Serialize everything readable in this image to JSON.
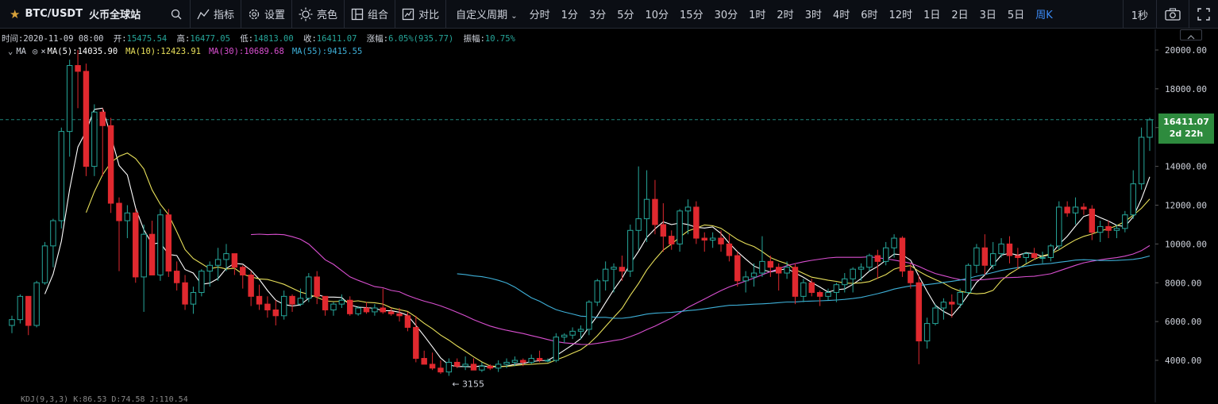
{
  "toolbar": {
    "symbol": "BTC/USDT",
    "exchange": "火币全球站",
    "tools": [
      {
        "label": "指标"
      },
      {
        "label": "设置"
      },
      {
        "label": "亮色"
      },
      {
        "label": "组合"
      },
      {
        "label": "对比"
      }
    ],
    "custom_period": "自定义周期",
    "periods": [
      "分时",
      "1分",
      "3分",
      "5分",
      "10分",
      "15分",
      "30分",
      "1时",
      "2时",
      "3时",
      "4时",
      "6时",
      "12时",
      "1日",
      "2日",
      "3日",
      "5日",
      "周K"
    ],
    "active_period": "周K",
    "refresh": "1秒"
  },
  "ohlc": {
    "time_label": "时间:",
    "time": "2020-11-09 08:00",
    "open_label": "开:",
    "open": "15475.54",
    "high_label": "高:",
    "high": "16477.05",
    "low_label": "低:",
    "low": "14813.00",
    "close_label": "收:",
    "close": "16411.07",
    "change_label": "涨幅:",
    "change": "6.05%(935.77)",
    "amp_label": "振幅:",
    "amp": "10.75%"
  },
  "ma_legend": {
    "name": "MA",
    "ma5": "MA(5):14035.90",
    "ma10": "MA(10):12423.91",
    "ma30": "MA(30):10689.68",
    "ma55": "MA(55):9415.55"
  },
  "kdj_legend": "KDJ(9,3,3)   K:86.53  D:74.58  J:110.54",
  "last_price": "16411.07",
  "countdown": "2d 22h",
  "low_marker": "← 3155",
  "colors": {
    "up": "#26a69a",
    "down": "#e0292f",
    "ma5": "#ffffff",
    "ma10": "#e8e05a",
    "ma30": "#d94fd0",
    "ma55": "#3eb0d8",
    "active": "#3c8bf5",
    "price_tag": "#2e8b3e"
  },
  "chart_data": {
    "type": "candlestick",
    "y_axis": {
      "ticks": [
        4000,
        6000,
        8000,
        10000,
        12000,
        14000,
        16000,
        18000,
        20000
      ],
      "range": [
        2700,
        21000
      ]
    },
    "candles": [
      [
        5800,
        6300,
        5400,
        6100
      ],
      [
        6100,
        7400,
        5900,
        7300
      ],
      [
        7300,
        6000,
        5300,
        5800
      ],
      [
        5800,
        8100,
        5700,
        8000
      ],
      [
        8000,
        10100,
        7900,
        9900
      ],
      [
        9900,
        11300,
        8800,
        11200
      ],
      [
        11200,
        16000,
        10800,
        15800
      ],
      [
        15800,
        19500,
        14500,
        19200
      ],
      [
        19200,
        20000,
        17000,
        18900
      ],
      [
        18900,
        19300,
        13500,
        14000
      ],
      [
        14000,
        17200,
        13500,
        16800
      ],
      [
        16800,
        17000,
        13500,
        16100
      ],
      [
        16100,
        16500,
        11600,
        12100
      ],
      [
        12100,
        12400,
        8600,
        11200
      ],
      [
        11200,
        12000,
        10300,
        11600
      ],
      [
        11600,
        11800,
        8000,
        8300
      ],
      [
        8300,
        11000,
        6500,
        10500
      ],
      [
        10500,
        11200,
        8600,
        8400
      ],
      [
        8400,
        11800,
        8100,
        11500
      ],
      [
        11500,
        11800,
        8300,
        8600
      ],
      [
        8600,
        9100,
        7600,
        8000
      ],
      [
        8000,
        8400,
        6600,
        6900
      ],
      [
        6900,
        7800,
        6400,
        7500
      ],
      [
        7500,
        8700,
        7300,
        8600
      ],
      [
        8600,
        9100,
        7800,
        8900
      ],
      [
        8900,
        9800,
        8100,
        9200
      ],
      [
        9200,
        10000,
        8600,
        9500
      ],
      [
        9500,
        9300,
        8400,
        8800
      ],
      [
        8800,
        8900,
        7700,
        8400
      ],
      [
        8400,
        8600,
        6800,
        7300
      ],
      [
        7300,
        7900,
        6600,
        6900
      ],
      [
        6900,
        7300,
        6200,
        6600
      ],
      [
        6600,
        7100,
        5800,
        6300
      ],
      [
        6300,
        7600,
        6100,
        7300
      ],
      [
        7300,
        7400,
        6500,
        6900
      ],
      [
        6900,
        7700,
        6800,
        7200
      ],
      [
        7200,
        8500,
        7000,
        8300
      ],
      [
        8300,
        8600,
        6900,
        7300
      ],
      [
        7300,
        7300,
        6300,
        6600
      ],
      [
        6600,
        7000,
        6300,
        6900
      ],
      [
        6900,
        7400,
        6700,
        7100
      ],
      [
        7100,
        7300,
        6300,
        6400
      ],
      [
        6400,
        6800,
        6300,
        6700
      ],
      [
        6700,
        7000,
        6400,
        6500
      ],
      [
        6500,
        6900,
        6300,
        6700
      ],
      [
        6700,
        7700,
        6400,
        6500
      ],
      [
        6500,
        6700,
        6300,
        6400
      ],
      [
        6400,
        6700,
        6000,
        6300
      ],
      [
        6300,
        6500,
        5500,
        5700
      ],
      [
        5700,
        6300,
        3900,
        4100
      ],
      [
        4100,
        4500,
        3800,
        3800
      ],
      [
        3800,
        4400,
        3500,
        3600
      ],
      [
        3600,
        4000,
        3300,
        3400
      ],
      [
        3400,
        4100,
        3200,
        3900
      ],
      [
        3900,
        4100,
        3600,
        3700
      ],
      [
        3700,
        4200,
        3500,
        3800
      ],
      [
        3800,
        4100,
        3500,
        3500
      ],
      [
        3500,
        3900,
        3400,
        3700
      ],
      [
        3700,
        3800,
        3500,
        3600
      ],
      [
        3600,
        4000,
        3400,
        3800
      ],
      [
        3800,
        4100,
        3600,
        3900
      ],
      [
        3900,
        4200,
        3700,
        4000
      ],
      [
        4000,
        4100,
        3700,
        3900
      ],
      [
        3900,
        4300,
        3800,
        4100
      ],
      [
        4100,
        4500,
        3900,
        4000
      ],
      [
        4000,
        4100,
        3900,
        4000
      ],
      [
        4000,
        5400,
        3900,
        5200
      ],
      [
        5200,
        5400,
        4900,
        5300
      ],
      [
        5300,
        5700,
        5100,
        5500
      ],
      [
        5500,
        5800,
        5100,
        5600
      ],
      [
        5600,
        7100,
        5300,
        7000
      ],
      [
        7000,
        8200,
        6800,
        8100
      ],
      [
        8100,
        9100,
        7600,
        8700
      ],
      [
        8700,
        9000,
        7500,
        8800
      ],
      [
        8800,
        9400,
        8100,
        8600
      ],
      [
        8600,
        11000,
        8300,
        10700
      ],
      [
        10700,
        14000,
        9700,
        11300
      ],
      [
        11300,
        13800,
        10100,
        12300
      ],
      [
        12300,
        13300,
        10500,
        11000
      ],
      [
        11000,
        12100,
        9600,
        10400
      ],
      [
        10400,
        10700,
        9700,
        10000
      ],
      [
        10000,
        11800,
        9600,
        11700
      ],
      [
        11700,
        12300,
        10500,
        11900
      ],
      [
        11900,
        12200,
        10000,
        10300
      ],
      [
        10300,
        10600,
        9600,
        10200
      ],
      [
        10200,
        10600,
        9800,
        10300
      ],
      [
        10300,
        10700,
        9600,
        10000
      ],
      [
        10000,
        10500,
        9100,
        9400
      ],
      [
        9400,
        9600,
        7800,
        8100
      ],
      [
        8100,
        8600,
        7500,
        8300
      ],
      [
        8300,
        9000,
        7800,
        8500
      ],
      [
        8500,
        10400,
        8300,
        9100
      ],
      [
        9100,
        9400,
        8300,
        8800
      ],
      [
        8800,
        9000,
        7600,
        8500
      ],
      [
        8500,
        9100,
        8200,
        8800
      ],
      [
        8800,
        9000,
        6900,
        7300
      ],
      [
        7300,
        8200,
        7000,
        8000
      ],
      [
        8000,
        8200,
        7300,
        7500
      ],
      [
        7500,
        7600,
        6800,
        7300
      ],
      [
        7300,
        7700,
        7100,
        7500
      ],
      [
        7500,
        8000,
        7000,
        7900
      ],
      [
        7900,
        8500,
        7500,
        8200
      ],
      [
        8200,
        8800,
        7500,
        8700
      ],
      [
        8700,
        9000,
        8100,
        8800
      ],
      [
        8800,
        9500,
        8600,
        9400
      ],
      [
        9400,
        9700,
        8200,
        9100
      ],
      [
        9100,
        10100,
        8900,
        9800
      ],
      [
        9800,
        10500,
        9300,
        10300
      ],
      [
        10300,
        10400,
        8300,
        8600
      ],
      [
        8600,
        9000,
        7700,
        8000
      ],
      [
        8000,
        8400,
        3800,
        5000
      ],
      [
        5000,
        6200,
        4600,
        5900
      ],
      [
        5900,
        6900,
        5800,
        6700
      ],
      [
        6700,
        7200,
        6100,
        7000
      ],
      [
        7000,
        7400,
        6200,
        6900
      ],
      [
        6900,
        7700,
        6700,
        7500
      ],
      [
        7500,
        9000,
        7400,
        8900
      ],
      [
        8900,
        10000,
        8500,
        9800
      ],
      [
        9800,
        10500,
        8400,
        8900
      ],
      [
        8900,
        10100,
        8700,
        9500
      ],
      [
        9500,
        10300,
        9300,
        10000
      ],
      [
        10000,
        10400,
        9000,
        9400
      ],
      [
        9400,
        9800,
        8700,
        9300
      ],
      [
        9300,
        9600,
        9000,
        9500
      ],
      [
        9500,
        9800,
        9200,
        9300
      ],
      [
        9300,
        9600,
        9000,
        9300
      ],
      [
        9300,
        10000,
        9100,
        9900
      ],
      [
        9900,
        12200,
        9700,
        11900
      ],
      [
        11900,
        12200,
        11400,
        11600
      ],
      [
        11600,
        12400,
        11000,
        11900
      ],
      [
        11900,
        12100,
        11500,
        11800
      ],
      [
        11800,
        12000,
        10200,
        10600
      ],
      [
        10600,
        11200,
        10100,
        10900
      ],
      [
        10900,
        11200,
        10300,
        10700
      ],
      [
        10700,
        11000,
        10300,
        10800
      ],
      [
        10800,
        11700,
        10600,
        11500
      ],
      [
        11500,
        13800,
        11300,
        13100
      ],
      [
        13100,
        16000,
        12800,
        15500
      ],
      [
        15500,
        16500,
        14800,
        16400
      ]
    ],
    "ma_series": [
      {
        "name": "MA(5)",
        "start": 4
      },
      {
        "name": "MA(10)",
        "start": 9
      },
      {
        "name": "MA(30)",
        "start": 29
      },
      {
        "name": "MA(55)",
        "start": 54
      }
    ],
    "last_price": 16411.07
  }
}
